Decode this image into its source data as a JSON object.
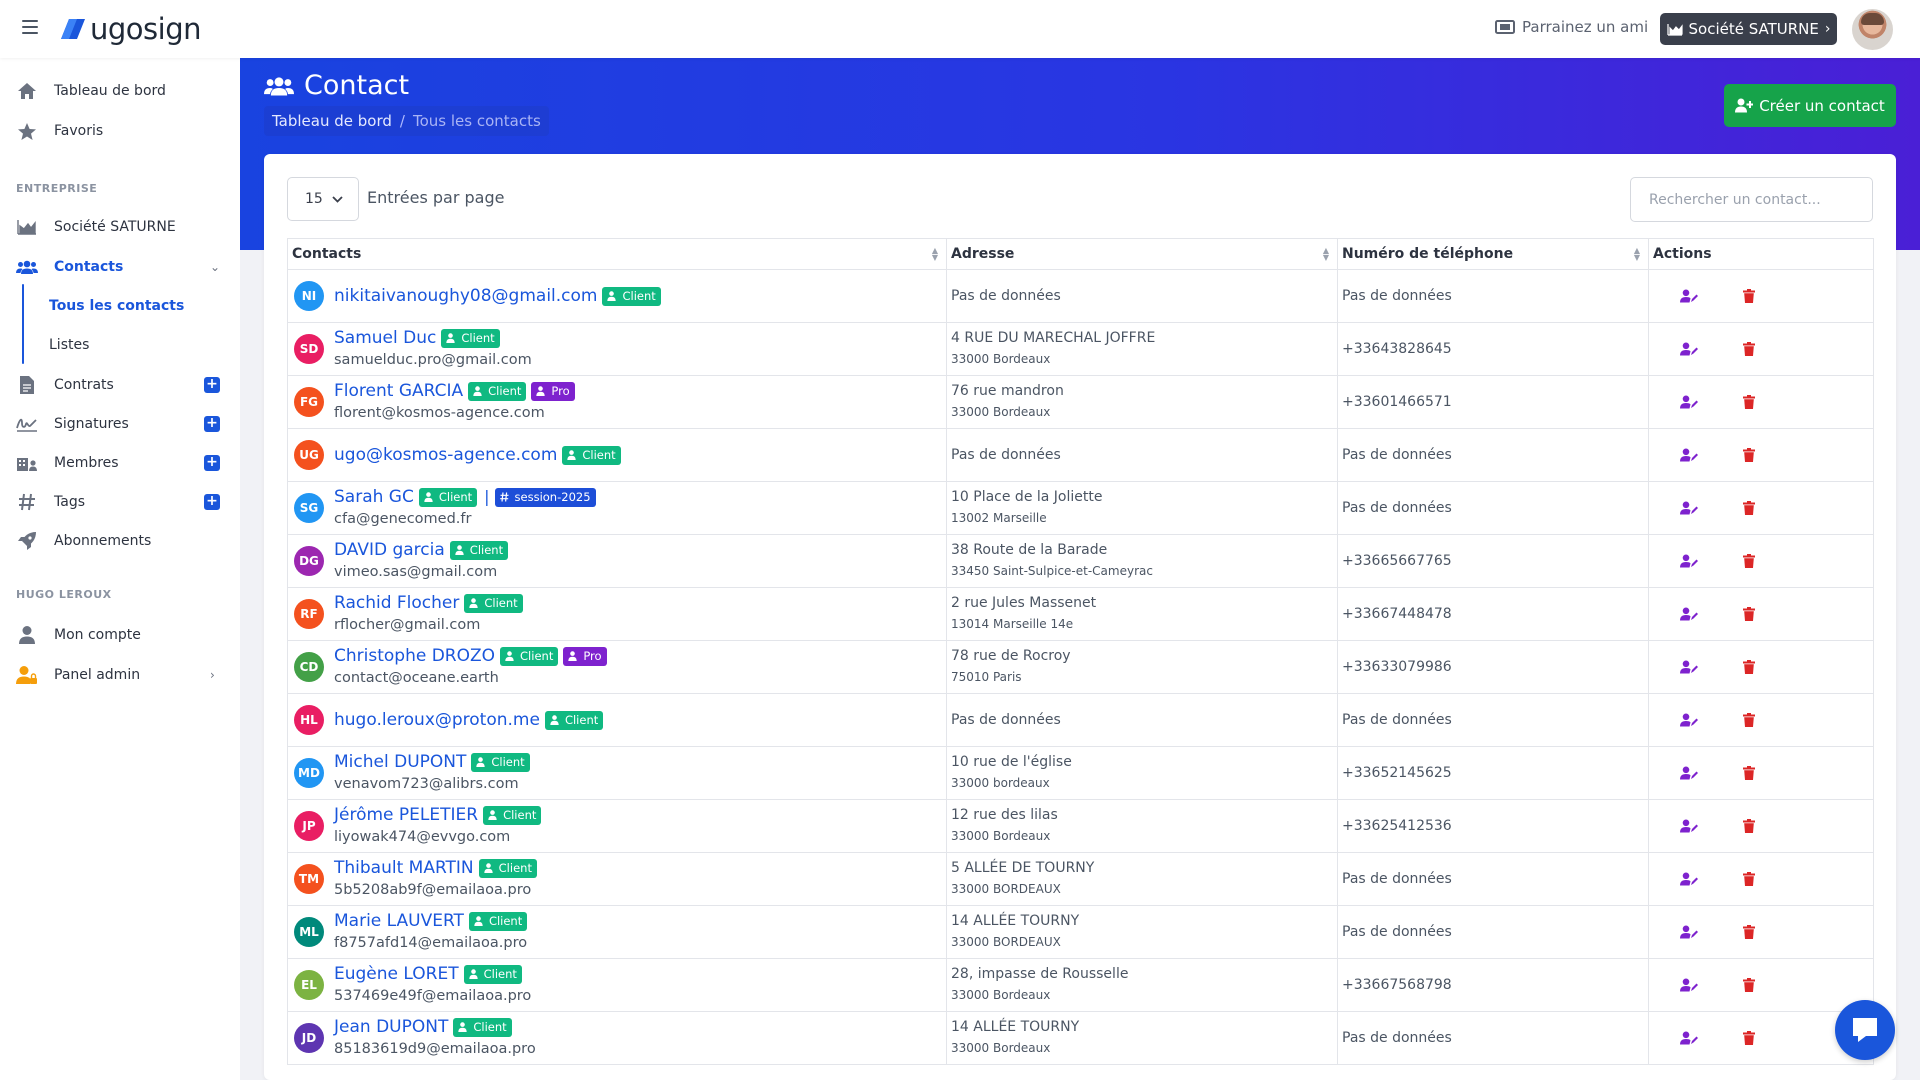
{
  "app": {
    "logo_text": "ugosign",
    "referral_label": "Parrainez un ami",
    "company_button": "Société SATURNE",
    "brand_color": "#1a56db"
  },
  "sidebar": {
    "items_top": [
      {
        "label": "Tableau de bord",
        "icon": "home-icon"
      },
      {
        "label": "Favoris",
        "icon": "star-icon"
      }
    ],
    "section_company": "ENTREPRISE",
    "company_item": "Société SATURNE",
    "contacts_item": "Contacts",
    "contacts_sub": [
      {
        "label": "Tous les contacts",
        "active": true
      },
      {
        "label": "Listes",
        "active": false
      }
    ],
    "items_company": [
      {
        "label": "Contrats",
        "icon": "document-icon"
      },
      {
        "label": "Signatures",
        "icon": "signature-icon"
      },
      {
        "label": "Membres",
        "icon": "members-icon"
      },
      {
        "label": "Tags",
        "icon": "hashtag-icon"
      },
      {
        "label": "Abonnements",
        "icon": "rocket-icon"
      }
    ],
    "section_user": "HUGO LEROUX",
    "items_user": [
      {
        "label": "Mon compte",
        "icon": "user-icon"
      },
      {
        "label": "Panel admin",
        "icon": "admin-icon"
      }
    ]
  },
  "header": {
    "title": "Contact",
    "breadcrumb": [
      "Tableau de bord",
      "Tous les contacts"
    ],
    "create_button": "Créer un contact"
  },
  "table_controls": {
    "per_page_value": "15",
    "per_page_label": "Entrées par page",
    "search_placeholder": "Rechercher un contact..."
  },
  "table": {
    "columns": [
      "Contacts",
      "Adresse",
      "Numéro de téléphone",
      "Actions"
    ],
    "rows": [
      {
        "initials": "NI",
        "color": "#2196f3",
        "name": "nikitaivanoughy08@gmail.com",
        "email": "",
        "tags": [
          "Client"
        ],
        "pipe": "",
        "addr1": "",
        "addr2": "",
        "no_addr": "Pas de données",
        "phone": "Pas de données"
      },
      {
        "initials": "SD",
        "color": "#e91e63",
        "name": "Samuel Duc",
        "email": "samuelduc.pro@gmail.com",
        "tags": [
          "Client"
        ],
        "pipe": "",
        "addr1": "4 RUE DU MARECHAL JOFFRE",
        "addr2": "33000 Bordeaux",
        "no_addr": "",
        "phone": "+33643828645"
      },
      {
        "initials": "FG",
        "color": "#f4511e",
        "name": "Florent GARCIA",
        "email": "florent@kosmos-agence.com",
        "tags": [
          "Client",
          "Pro"
        ],
        "pipe": "",
        "addr1": "76 rue mandron",
        "addr2": "33000 Bordeaux",
        "no_addr": "",
        "phone": "+33601466571"
      },
      {
        "initials": "UG",
        "color": "#f4511e",
        "name": "ugo@kosmos-agence.com",
        "email": "",
        "tags": [
          "Client"
        ],
        "pipe": "",
        "addr1": "",
        "addr2": "",
        "no_addr": "Pas de données",
        "phone": "Pas de données"
      },
      {
        "initials": "SG",
        "color": "#2196f3",
        "name": "Sarah GC",
        "email": "cfa@genecomed.fr",
        "tags": [
          "Client"
        ],
        "pipe": "|",
        "session_tag": "session-2025",
        "addr1": "10 Place de la Joliette",
        "addr2": "13002 Marseille",
        "no_addr": "",
        "phone": "Pas de données"
      },
      {
        "initials": "DG",
        "color": "#9c27b0",
        "name": "DAVID garcia",
        "email": "vimeo.sas@gmail.com",
        "tags": [
          "Client"
        ],
        "pipe": "",
        "addr1": "38 Route de la Barade",
        "addr2": "33450 Saint-Sulpice-et-Cameyrac",
        "no_addr": "",
        "phone": "+33665667765"
      },
      {
        "initials": "RF",
        "color": "#f4511e",
        "name": "Rachid Flocher",
        "email": "rflocher@gmail.com",
        "tags": [
          "Client"
        ],
        "pipe": "",
        "addr1": "2 rue Jules Massenet",
        "addr2": "13014 Marseille 14e",
        "no_addr": "",
        "phone": "+33667448478"
      },
      {
        "initials": "CD",
        "color": "#43a047",
        "name": "Christophe DROZO",
        "email": "contact@oceane.earth",
        "tags": [
          "Client",
          "Pro"
        ],
        "pipe": "",
        "addr1": "78 rue de Rocroy",
        "addr2": "75010 Paris",
        "no_addr": "",
        "phone": "+33633079986"
      },
      {
        "initials": "HL",
        "color": "#e91e63",
        "name": "hugo.leroux@proton.me",
        "email": "",
        "tags": [
          "Client"
        ],
        "pipe": "",
        "addr1": "",
        "addr2": "",
        "no_addr": "Pas de données",
        "phone": "Pas de données"
      },
      {
        "initials": "MD",
        "color": "#2196f3",
        "name": "Michel DUPONT",
        "email": "venavom723@alibrs.com",
        "tags": [
          "Client"
        ],
        "pipe": "",
        "addr1": "10 rue de l'église",
        "addr2": "33000 bordeaux",
        "no_addr": "",
        "phone": "+33652145625"
      },
      {
        "initials": "JP",
        "color": "#e91e63",
        "name": "Jérôme PELETIER",
        "email": "liyowak474@evvgo.com",
        "tags": [
          "Client"
        ],
        "pipe": "",
        "addr1": "12 rue des lilas",
        "addr2": "33000 Bordeaux",
        "no_addr": "",
        "phone": "+33625412536"
      },
      {
        "initials": "TM",
        "color": "#f4511e",
        "name": "Thibault MARTIN",
        "email": "5b5208ab9f@emailaoa.pro",
        "tags": [
          "Client"
        ],
        "pipe": "",
        "addr1": "5 ALLÉE DE TOURNY",
        "addr2": "33000 BORDEAUX",
        "no_addr": "",
        "phone": "Pas de données"
      },
      {
        "initials": "ML",
        "color": "#00897b",
        "name": "Marie LAUVERT",
        "email": "f8757afd14@emailaoa.pro",
        "tags": [
          "Client"
        ],
        "pipe": "",
        "addr1": "14 ALLÉE TOURNY",
        "addr2": "33000 BORDEAUX",
        "no_addr": "",
        "phone": "Pas de données"
      },
      {
        "initials": "EL",
        "color": "#7cb342",
        "name": "Eugène LORET",
        "email": "537469e49f@emailaoa.pro",
        "tags": [
          "Client"
        ],
        "pipe": "",
        "addr1": "28, impasse de Rousselle",
        "addr2": "33000 Bordeaux",
        "no_addr": "",
        "phone": "+33667568798"
      },
      {
        "initials": "JD",
        "color": "#5e35b1",
        "name": "Jean DUPONT",
        "email": "85183619d9@emailaoa.pro",
        "tags": [
          "Client"
        ],
        "pipe": "",
        "addr1": "14 ALLÉE TOURNY",
        "addr2": "33000 Bordeaux",
        "no_addr": "",
        "phone": "Pas de données"
      }
    ]
  },
  "colors": {
    "header_gradient_start": "#1943e0",
    "header_gradient_end": "#4a1fd6",
    "create_button": "#16a34a",
    "badge_client": "#10b981",
    "badge_pro": "#7e22ce",
    "badge_session": "#1d4ed8",
    "edit_icon": "#7e22ce",
    "delete_icon": "#dc2626"
  }
}
